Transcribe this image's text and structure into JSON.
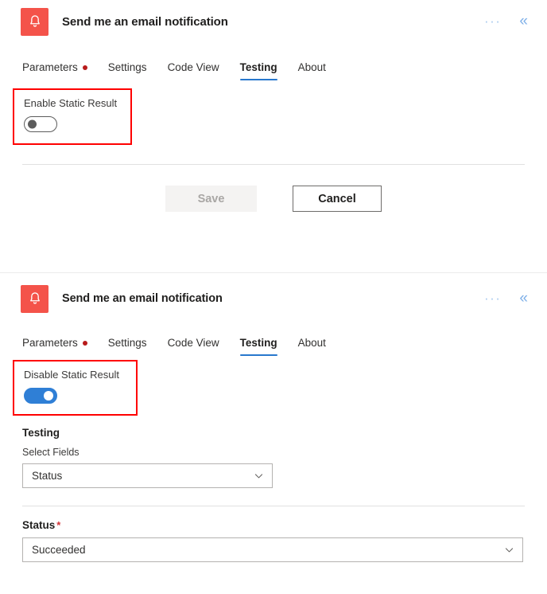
{
  "panels": [
    {
      "header": {
        "icon": "bell-icon",
        "icon_bg": "#f4534a",
        "title": "Send me an email notification",
        "more_label": "···",
        "collapse_label": "«"
      },
      "tabs": [
        {
          "label": "Parameters",
          "active": false,
          "dot": true
        },
        {
          "label": "Settings",
          "active": false,
          "dot": false
        },
        {
          "label": "Code View",
          "active": false,
          "dot": false
        },
        {
          "label": "Testing",
          "active": true,
          "dot": false
        },
        {
          "label": "About",
          "active": false,
          "dot": false
        }
      ],
      "static_result": {
        "label": "Enable Static Result",
        "toggle_state": "off",
        "highlight_color": "#ff0000"
      },
      "actions": {
        "save_label": "Save",
        "cancel_label": "Cancel"
      }
    },
    {
      "header": {
        "icon": "bell-icon",
        "icon_bg": "#f4534a",
        "title": "Send me an email notification",
        "more_label": "···",
        "collapse_label": "«"
      },
      "tabs": [
        {
          "label": "Parameters",
          "active": false,
          "dot": true
        },
        {
          "label": "Settings",
          "active": false,
          "dot": false
        },
        {
          "label": "Code View",
          "active": false,
          "dot": false
        },
        {
          "label": "Testing",
          "active": true,
          "dot": false
        },
        {
          "label": "About",
          "active": false,
          "dot": false
        }
      ],
      "static_result": {
        "label": "Disable Static Result",
        "toggle_state": "on",
        "highlight_color": "#ff0000"
      },
      "testing": {
        "section_title": "Testing",
        "select_fields_label": "Select Fields",
        "select_fields_value": "Status",
        "status_label": "Status",
        "status_required_marker": "*",
        "status_value": "Succeeded"
      }
    }
  ],
  "colors": {
    "accent": "#2878cd",
    "toggle_on": "#2f7fd6",
    "tab_dot": "#b81b1b",
    "required": "#d13438",
    "icon_bg": "#f4534a"
  }
}
